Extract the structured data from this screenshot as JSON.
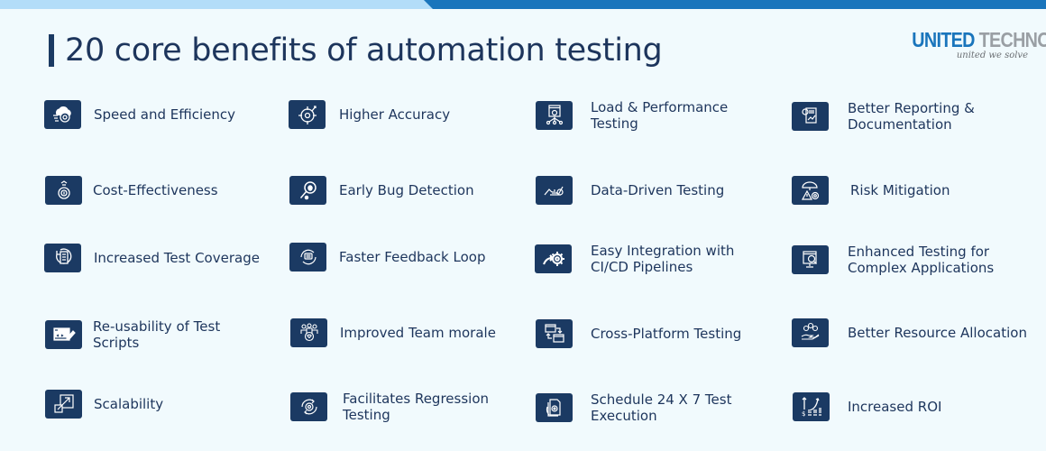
{
  "header": {
    "title": "20 core benefits of automation testing"
  },
  "logo": {
    "brand_part1": "UNITED",
    "brand_part2": "TECHNO",
    "tagline": "united we solve"
  },
  "colors": {
    "background": "#f1fafd",
    "band_light": "#b3ddf9",
    "band_dark": "#1a75bc",
    "icon_bg": "#1b3a63",
    "text": "#1d355c",
    "logo_blue": "#1a75bc",
    "logo_gray": "#9a9fa4"
  },
  "benefits": [
    {
      "label": "Speed and Efficiency",
      "icon": "cloud-gear-speed-icon"
    },
    {
      "label": "Higher Accuracy",
      "icon": "target-gear-icon"
    },
    {
      "label": "Load & Performance Testing",
      "icon": "browser-network-icon"
    },
    {
      "label": "Better Reporting & Documentation",
      "icon": "report-chart-icon"
    },
    {
      "label": "Cost-Effectiveness",
      "icon": "money-bag-gear-icon"
    },
    {
      "label": "Early Bug Detection",
      "icon": "magnifier-bug-icon"
    },
    {
      "label": "Data-Driven Testing",
      "icon": "data-chart-icon"
    },
    {
      "label": "Risk Mitigation",
      "icon": "umbrella-warning-icon"
    },
    {
      "label": "Increased Test Coverage",
      "icon": "checklist-cycle-icon"
    },
    {
      "label": "Faster Feedback Loop",
      "icon": "chat-cycle-icon"
    },
    {
      "label": "Easy Integration with CI/CD Pipelines",
      "icon": "arrow-gear-icon"
    },
    {
      "label": "Enhanced Testing for Complex Applications",
      "icon": "monitor-search-icon"
    },
    {
      "label": "Re-usability of Test Scripts",
      "icon": "code-card-pen-icon"
    },
    {
      "label": "Improved Team morale",
      "icon": "team-heart-icon"
    },
    {
      "label": "Cross-Platform Testing",
      "icon": "windows-swap-icon"
    },
    {
      "label": "Better Resource Allocation",
      "icon": "hand-coins-icon"
    },
    {
      "label": "Scalability",
      "icon": "scale-arrow-icon"
    },
    {
      "label": "Facilitates Regression Testing",
      "icon": "gear-cycle-icon"
    },
    {
      "label": "Schedule 24 X 7 Test Execution",
      "icon": "document-gear-cycle-icon"
    },
    {
      "label": "Increased ROI",
      "icon": "growth-chart-dollar-icon"
    }
  ]
}
